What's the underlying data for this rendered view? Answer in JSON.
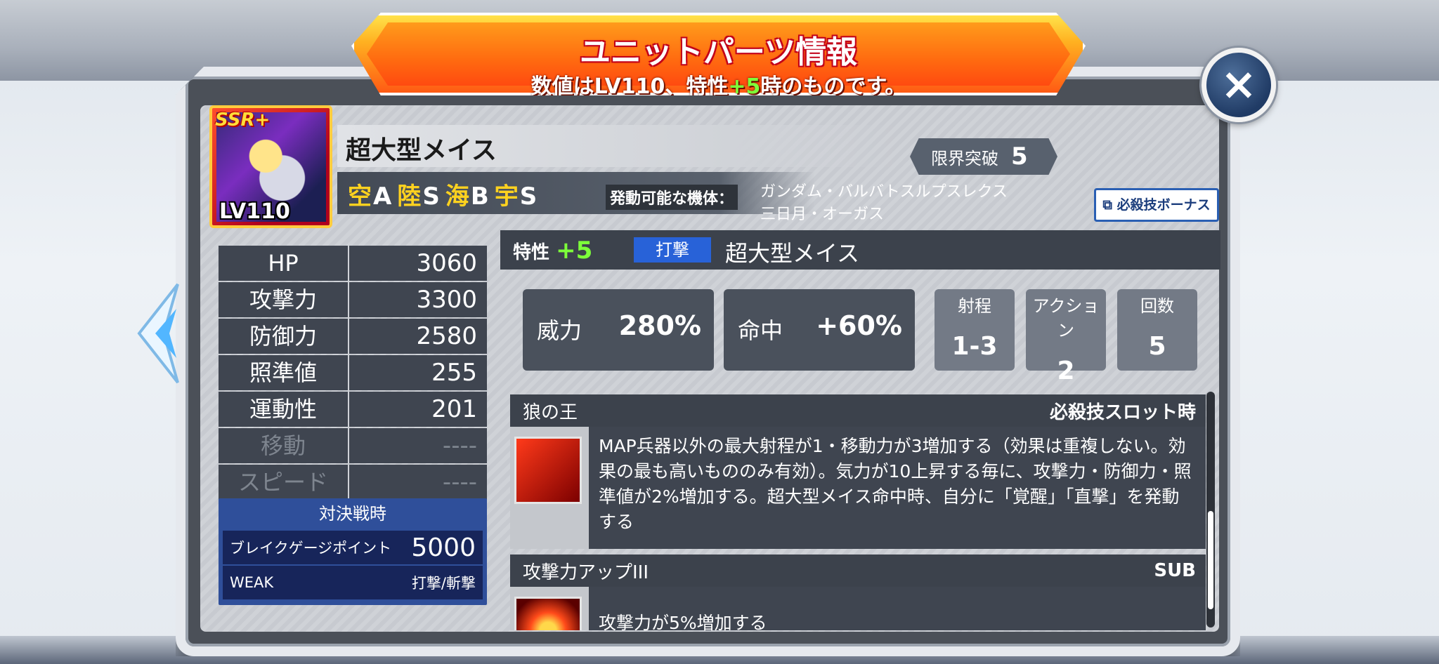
{
  "banner": {
    "title": "ユニットパーツ情報",
    "subtitle_a": "数値はLV110、特性",
    "subtitle_green": "+5",
    "subtitle_b": "時のものです。"
  },
  "close_label": "×",
  "part": {
    "rarity": "SSR+",
    "level": "LV110",
    "name": "超大型メイス",
    "limit_break_label": "限界突破",
    "limit_break_value": "5",
    "terrain": [
      {
        "k": "空",
        "v": "A"
      },
      {
        "k": "陸",
        "v": "S"
      },
      {
        "k": "海",
        "v": "B"
      },
      {
        "k": "宇",
        "v": "S"
      }
    ],
    "units_label": "発動可能な機体：",
    "units_line1": "ガンダム・バルバトスルプスレクス",
    "units_line2": "三日月・オーガス",
    "bonus_button": "必殺技ボーナス"
  },
  "stats": [
    {
      "label": "HP",
      "value": "3060",
      "dim": false
    },
    {
      "label": "攻撃力",
      "value": "3300",
      "dim": false
    },
    {
      "label": "防御力",
      "value": "2580",
      "dim": false
    },
    {
      "label": "照準値",
      "value": "255",
      "dim": false
    },
    {
      "label": "運動性",
      "value": "201",
      "dim": false
    },
    {
      "label": "移動",
      "value": "----",
      "dim": true
    },
    {
      "label": "スピード",
      "value": "----",
      "dim": true
    }
  ],
  "battle": {
    "title": "対決戦時",
    "break_label": "ブレイクゲージポイント",
    "break_value": "5000",
    "weak_label": "WEAK",
    "weak_value": "打撃/斬撃"
  },
  "weapon": {
    "trait_label": "特性",
    "trait_value": "+5",
    "type": "打撃",
    "name": "超大型メイス",
    "power_label": "威力",
    "power_value": "280%",
    "hit_label": "命中",
    "hit_value": "+60%",
    "range_label": "射程",
    "range_value": "1-3",
    "action_label": "アクション",
    "action_value": "2",
    "count_label": "回数",
    "count_value": "5"
  },
  "skills": [
    {
      "name": "狼の王",
      "tag": "必殺技スロット時",
      "text": "MAP兵器以外の最大射程が1・移動力が3増加する（効果は重複しない。効果の最も高いもののみ有効）。気力が10上昇する毎に、攻撃力・防御力・照準値が2%増加する。超大型メイス命中時、自分に「覚醒」「直撃」を発動する"
    },
    {
      "name": "攻撃力アップIII",
      "tag": "SUB",
      "text": "攻撃力が5%増加する"
    }
  ],
  "colors": {
    "accent_green": "#7dff3a",
    "badge_blue": "#2862d8",
    "panel_dark": "#3f4550"
  }
}
